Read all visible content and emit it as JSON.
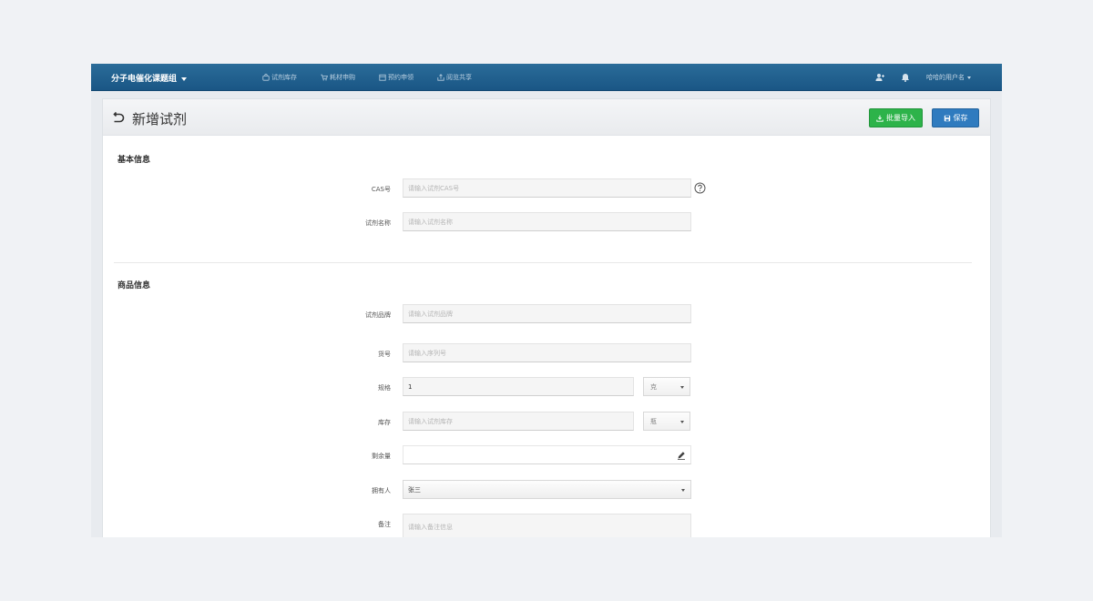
{
  "topbar": {
    "brand": "分子电催化课题组",
    "nav": [
      {
        "label": "试剂库存",
        "icon": "bag-icon"
      },
      {
        "label": "耗材申购",
        "icon": "cart-icon"
      },
      {
        "label": "预约申领",
        "icon": "calendar-icon"
      },
      {
        "label": "阅览共享",
        "icon": "share-icon"
      }
    ],
    "user_name": "哈哈的用户名"
  },
  "page": {
    "title": "新增试剂",
    "import_label": "批量导入",
    "save_label": "保存"
  },
  "basic": {
    "section_title": "基本信息",
    "cas_label": "CAS号",
    "cas_placeholder": "请输入试剂CAS号",
    "name_label": "试剂名称",
    "name_placeholder": "请输入试剂名称"
  },
  "product": {
    "section_title": "商品信息",
    "brand_label": "试剂品牌",
    "brand_placeholder": "请输入试剂品牌",
    "serial_label": "货号",
    "serial_placeholder": "请输入序列号",
    "spec_label": "规格",
    "spec_value": "1",
    "spec_unit": "克",
    "stock_label": "库存",
    "stock_placeholder": "请输入试剂库存",
    "stock_unit": "瓶",
    "remain_label": "剩余量",
    "remain_value": "",
    "owner_label": "拥有人",
    "owner_value": "张三",
    "note_label": "备注",
    "note_placeholder": "请输入备注信息"
  },
  "colors": {
    "topbar": "#1f5f8d",
    "import_button": "#2db34a",
    "save_button": "#2f7bbf"
  }
}
